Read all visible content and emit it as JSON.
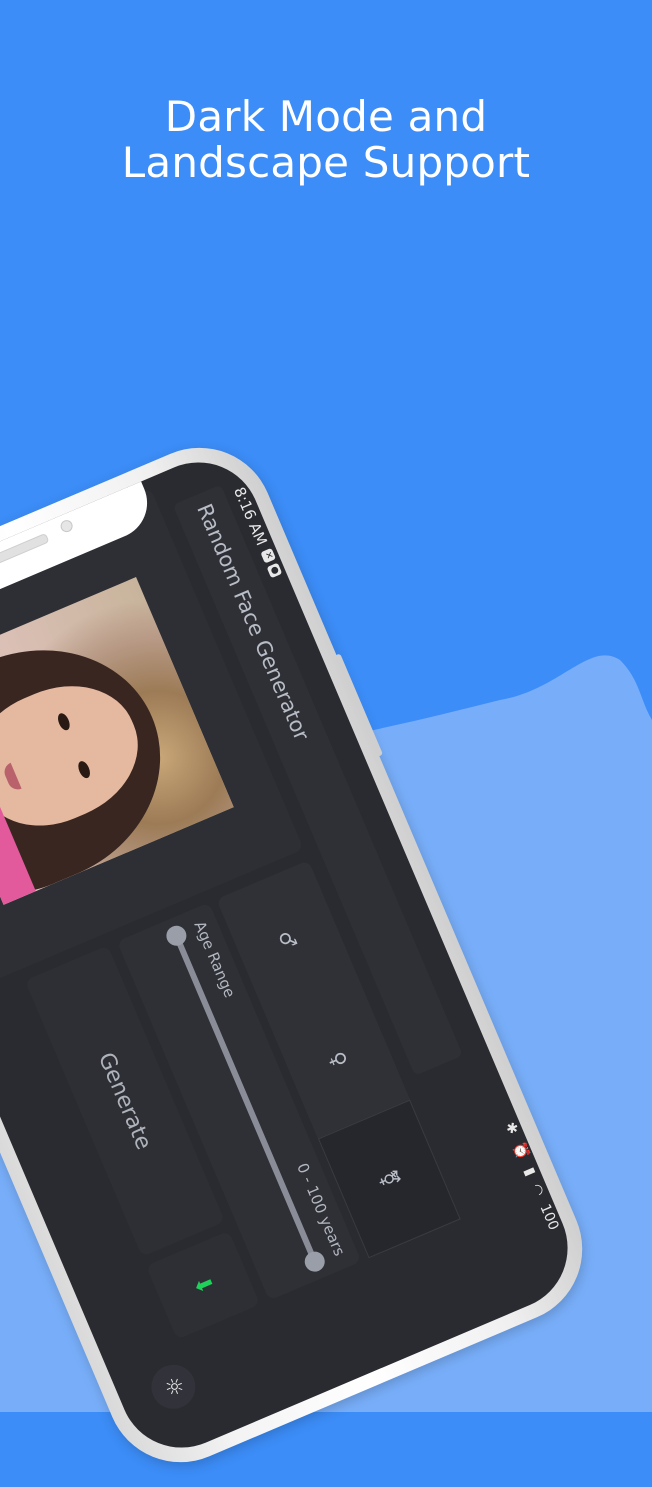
{
  "headline": {
    "line1": "Dark Mode and",
    "line2": "Landscape Support"
  },
  "colors": {
    "background_top": "#3c8df8",
    "background_wave": "#78aef9",
    "app_bg": "#2a2b30",
    "download_accent": "#1fd05a"
  },
  "statusbar": {
    "time": "8:16 AM",
    "battery": "100"
  },
  "app": {
    "title": "Random Face Generator",
    "gender": {
      "male_icon": "♂",
      "female_icon": "♀",
      "any_icon": "⚧"
    },
    "age": {
      "label": "Age Range",
      "value": "0 - 100 years",
      "min_fraction": 0.0,
      "max_fraction": 1.0
    },
    "generate_label": "Generate",
    "download_icon": "download-icon",
    "theme_icon": "brightness-icon"
  }
}
